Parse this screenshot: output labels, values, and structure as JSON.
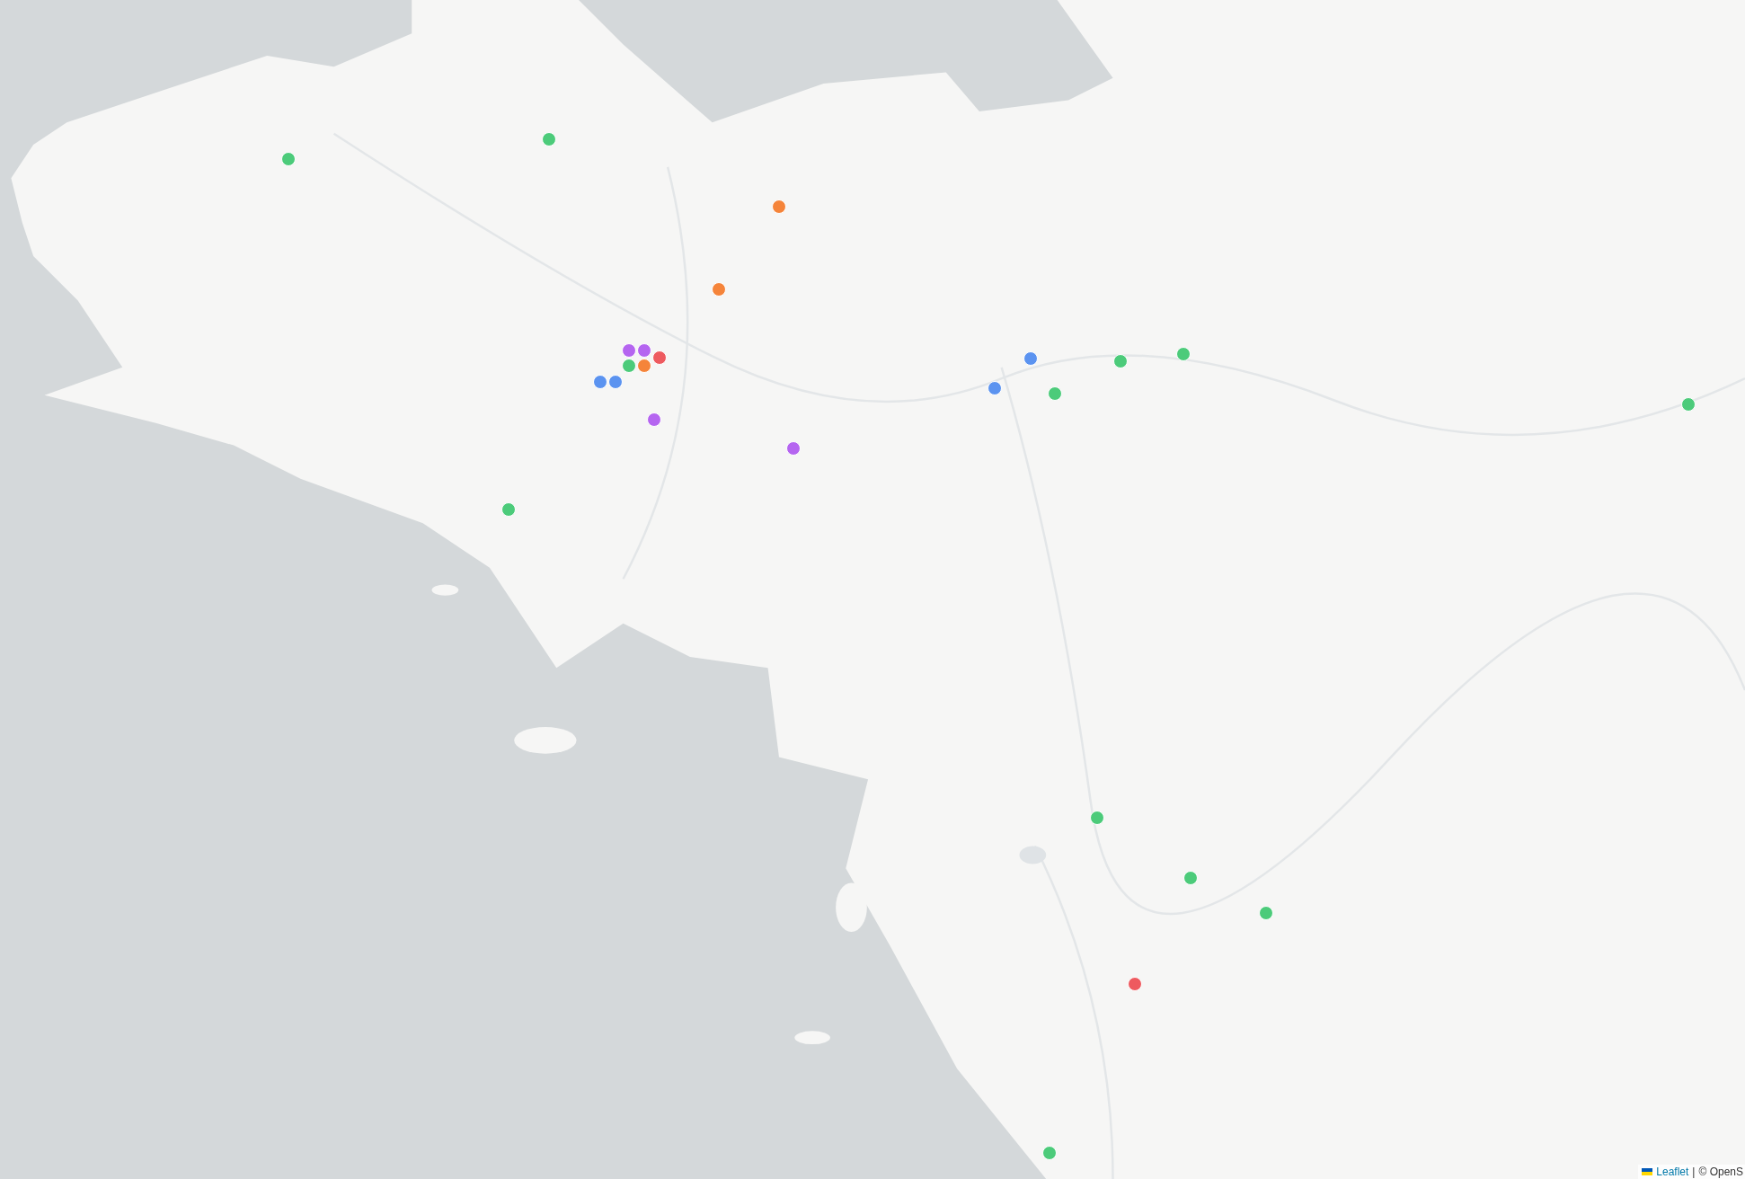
{
  "markers": [
    {
      "color": "#4ccb7a"
    },
    {
      "color": "#4ccb7a"
    },
    {
      "color": "#f5843a"
    },
    {
      "color": "#f5843a"
    },
    {
      "color": "#b565f0"
    },
    {
      "color": "#b565f0"
    },
    {
      "color": "#ee5a5f"
    },
    {
      "color": "#4ccb7a"
    },
    {
      "color": "#f5843a"
    },
    {
      "color": "#5b93f0"
    },
    {
      "color": "#5b93f0"
    },
    {
      "color": "#b565f0"
    },
    {
      "color": "#b565f0"
    },
    {
      "color": "#4ccb7a"
    },
    {
      "color": "#5b93f0"
    },
    {
      "color": "#5b93f0"
    },
    {
      "color": "#4ccb7a"
    },
    {
      "color": "#4ccb7a"
    },
    {
      "color": "#4ccb7a"
    },
    {
      "color": "#4ccb7a"
    },
    {
      "color": "#4ccb7a"
    },
    {
      "color": "#4ccb7a"
    },
    {
      "color": "#4ccb7a"
    },
    {
      "color": "#ee5a5f"
    },
    {
      "color": "#4ccb7a"
    }
  ],
  "attribution": {
    "link": "Leaflet",
    "separator": "|",
    "text": "© OpenS"
  }
}
